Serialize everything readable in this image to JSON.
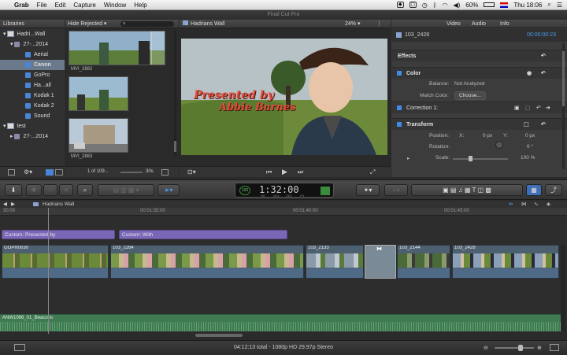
{
  "menubar": {
    "app": "Grab",
    "items": [
      "File",
      "Edit",
      "Capture",
      "Window",
      "Help"
    ],
    "battery": "60%",
    "clock": "Thu 18:06"
  },
  "window_title": "Final Cut Pro",
  "libraries": {
    "header": "Libraries",
    "rows": [
      {
        "label": "Hadri...Wall",
        "kind": "library"
      },
      {
        "label": "27-...2014",
        "kind": "date"
      },
      {
        "label": "Aerial",
        "kind": "event"
      },
      {
        "label": "Canon",
        "kind": "event",
        "selected": true
      },
      {
        "label": "GoPro",
        "kind": "event"
      },
      {
        "label": "Ha...all",
        "kind": "event"
      },
      {
        "label": "Kodak 1",
        "kind": "event"
      },
      {
        "label": "Kodak 2",
        "kind": "event"
      },
      {
        "label": "Sound",
        "kind": "event"
      },
      {
        "label": "test",
        "kind": "library"
      },
      {
        "label": "27-...2014",
        "kind": "date"
      }
    ]
  },
  "browser": {
    "filter": "Hide Rejected",
    "clips": [
      "MVI_2882",
      "",
      "MVI_2883"
    ],
    "selection_count": "1 of 109...",
    "duration": "30s"
  },
  "viewer": {
    "title": "Hadrians Wall",
    "zoom": "24%",
    "overlay_line1": "Presented by",
    "overlay_line2": "Abbie Barnes"
  },
  "inspector": {
    "tabs": [
      "Video",
      "Audio",
      "Info"
    ],
    "clip_name": "103_2428",
    "timecode": "00:00:00:23",
    "effects_label": "Effects",
    "color_label": "Color",
    "balance_label": "Balance:",
    "balance_value": "Not Analyzed",
    "match_color_label": "Match Color:",
    "choose_label": "Choose...",
    "correction_label": "Correction 1:",
    "transform_label": "Transform",
    "position_label": "Position:",
    "x_label": "X:",
    "x_value": "0 px",
    "y_label": "Y:",
    "y_value": "0 px",
    "rotation_label": "Rotation:",
    "rotation_value": "0 °",
    "scale_label": "Scale:",
    "scale_value": "100 %"
  },
  "toolbar": {
    "timecode": "1:32:00",
    "tc_hr": "HR",
    "tc_min": "MIN",
    "tc_sec": "SEC",
    "tc_fr": "FR",
    "tc_percent": "100"
  },
  "timeline": {
    "project": "Hadrians Wall",
    "ruler": [
      "30:00",
      "00:01:35:00",
      "00:01:40:00",
      "00:01:45:00"
    ],
    "title_clips": [
      {
        "label": "Custom: Presented by"
      },
      {
        "label": "Custom:          With"
      }
    ],
    "video_clips": [
      "GOPR0030",
      "103_2264",
      "103_2133",
      "103_2144",
      "103_2428"
    ],
    "audio_clip": "ANW1066_01_Beacons"
  },
  "status": {
    "text": "04:12:13 total - 1080p HD 29.97p Stereo"
  }
}
